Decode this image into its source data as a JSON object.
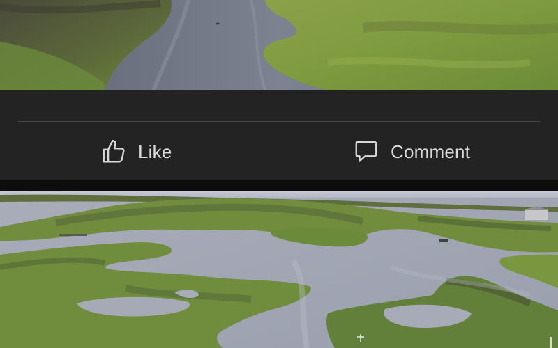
{
  "post_top": {
    "photo_alt": "river-through-marsh-photo"
  },
  "actions": {
    "like_label": "Like",
    "comment_label": "Comment",
    "like_icon": "thumbs-up-icon",
    "comment_icon": "speech-bubble-icon"
  },
  "post_bottom": {
    "photo_alt": "aerial-marsh-photo"
  },
  "colors": {
    "bar_bg": "#232323",
    "label": "#d9d9d9",
    "divider": "#474747"
  }
}
